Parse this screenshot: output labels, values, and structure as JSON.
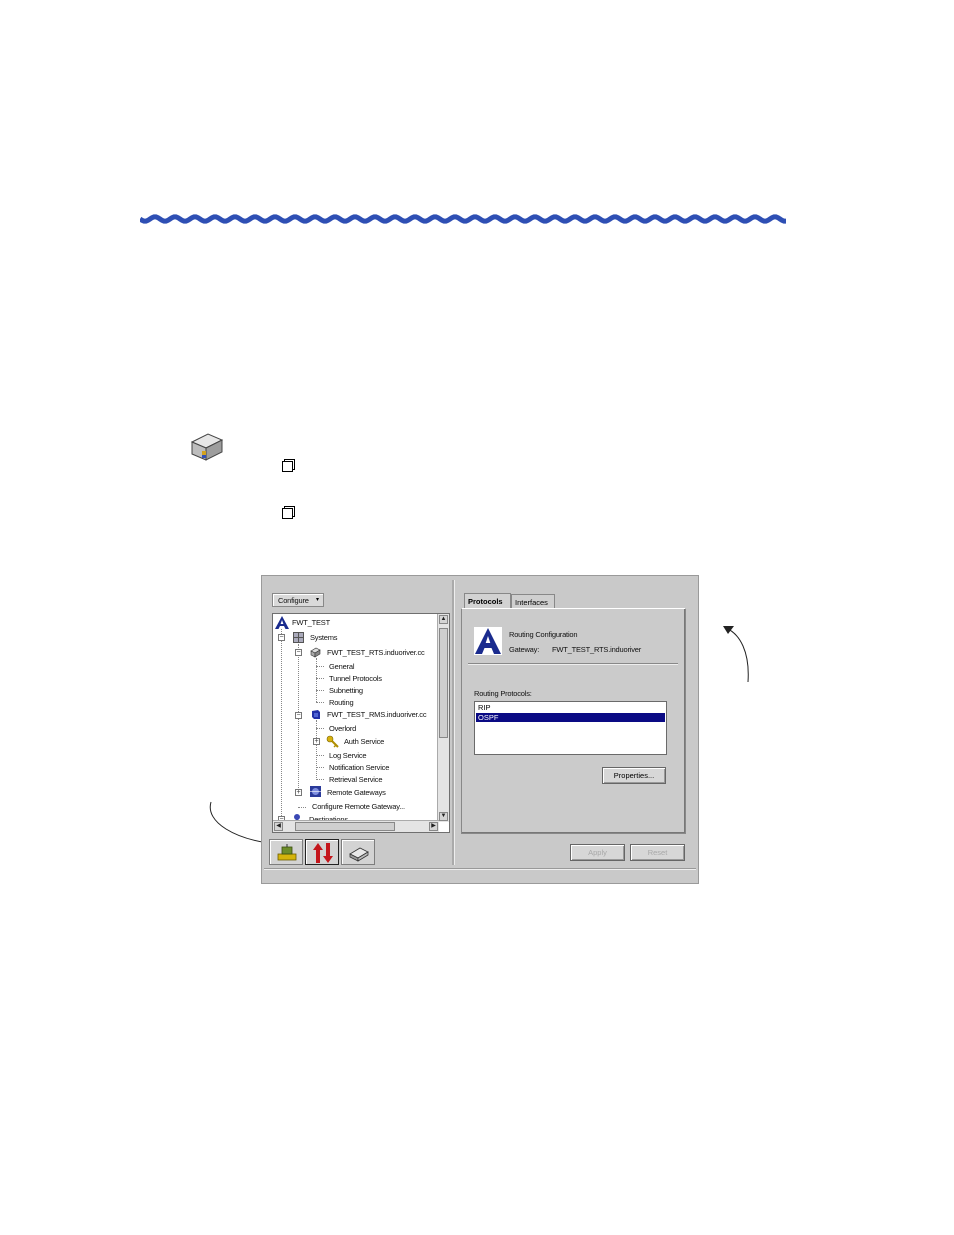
{
  "colors": {
    "rule": "#2e4fb4",
    "selection": "#0a0a84",
    "tool_red": "#c4161c"
  },
  "window": {
    "configure_menu": {
      "label": "Configure",
      "icon": "dropdown-arrow-icon"
    },
    "tree": [
      {
        "label": "FWT_TEST",
        "icon": "a-logo-icon"
      },
      {
        "label": "Systems",
        "icon": "systems-grid-icon"
      },
      {
        "label": "FWT_TEST_RTS.induoriver.cc",
        "icon": "gateway-icon"
      },
      {
        "label": "General"
      },
      {
        "label": "Tunnel Protocols"
      },
      {
        "label": "Subnetting"
      },
      {
        "label": "Routing"
      },
      {
        "label": "FWT_TEST_RMS.induoriver.cc",
        "icon": "server-icon"
      },
      {
        "label": "Overlord"
      },
      {
        "label": "Auth Service",
        "icon": "keys-icon"
      },
      {
        "label": "Log Service"
      },
      {
        "label": "Notification Service"
      },
      {
        "label": "Retrieval Service"
      },
      {
        "label": "Remote Gateways",
        "icon": "remote-gateways-icon"
      },
      {
        "label": "Configure Remote Gateway..."
      },
      {
        "label": "Destinations",
        "icon": "destinations-icon"
      }
    ],
    "tools": [
      "network-tool-icon",
      "traffic-arrows-icon",
      "book-icon"
    ],
    "tabs": [
      {
        "label": "Protocols"
      },
      {
        "label": "Interfaces"
      }
    ],
    "header": {
      "title": "Routing Configuration",
      "gateway_label": "Gateway:",
      "gateway_value": "FWT_TEST_RTS.induoriver"
    },
    "routing_protocols": {
      "label": "Routing Protocols:",
      "items": [
        "RIP",
        "OSPF"
      ]
    },
    "buttons": {
      "properties": "Properties...",
      "apply": "Apply",
      "reset": "Reset"
    }
  }
}
